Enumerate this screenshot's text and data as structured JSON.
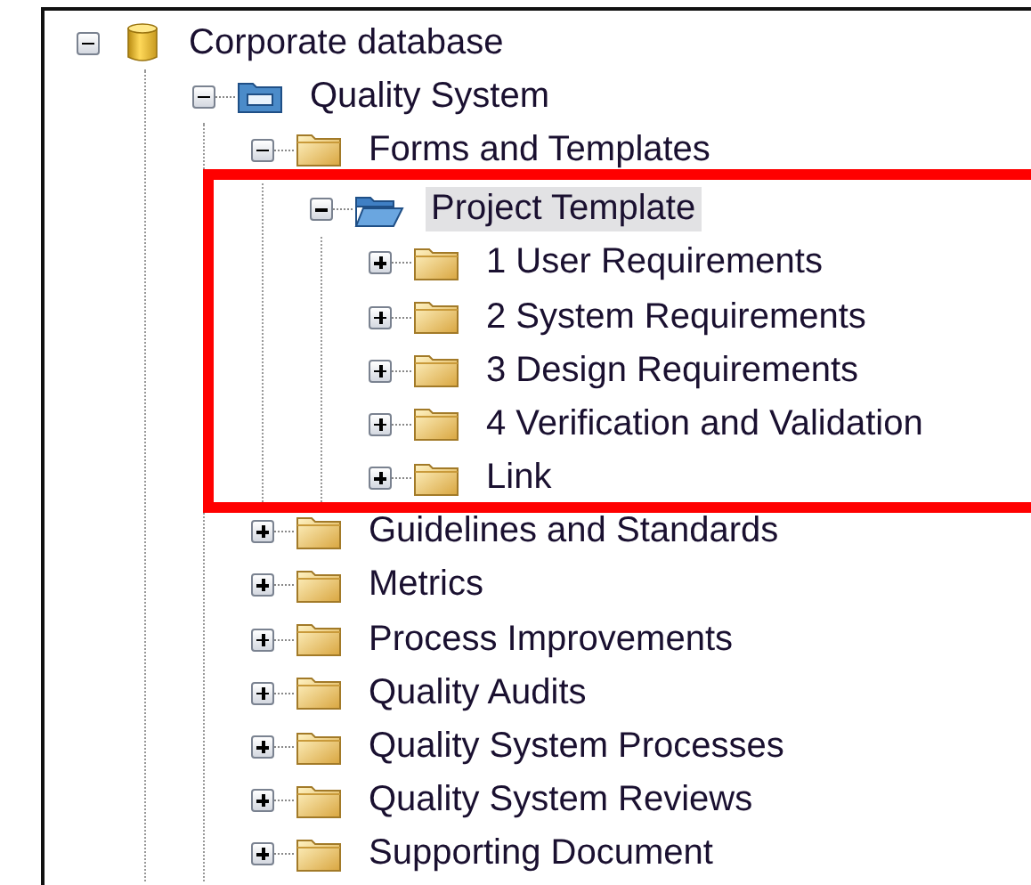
{
  "tree": [
    {
      "label": "Corporate database",
      "kind": "database",
      "expanded": true,
      "selected": false,
      "children": [
        {
          "label": "Quality System",
          "kind": "module",
          "expanded": true,
          "selected": false,
          "children": [
            {
              "label": "Forms and Templates",
              "kind": "folder",
              "expanded": true,
              "selected": false,
              "children": [
                {
                  "label": "Project Template",
                  "kind": "open-folder",
                  "expanded": true,
                  "selected": true,
                  "highlighted": true,
                  "children": [
                    {
                      "label": "1 User Requirements",
                      "kind": "folder",
                      "expanded": false,
                      "selected": false
                    },
                    {
                      "label": "2  System Requirements",
                      "kind": "folder",
                      "expanded": false,
                      "selected": false
                    },
                    {
                      "label": "3 Design Requirements",
                      "kind": "folder",
                      "expanded": false,
                      "selected": false
                    },
                    {
                      "label": "4 Verification and Validation",
                      "kind": "folder",
                      "expanded": false,
                      "selected": false
                    },
                    {
                      "label": "Link",
                      "kind": "folder",
                      "expanded": false,
                      "selected": false
                    }
                  ]
                }
              ]
            },
            {
              "label": "Guidelines and Standards",
              "kind": "folder",
              "expanded": false,
              "selected": false
            },
            {
              "label": "Metrics",
              "kind": "folder",
              "expanded": false,
              "selected": false
            },
            {
              "label": "Process Improvements",
              "kind": "folder",
              "expanded": false,
              "selected": false
            },
            {
              "label": "Quality Audits",
              "kind": "folder",
              "expanded": false,
              "selected": false
            },
            {
              "label": "Quality System Processes",
              "kind": "folder",
              "expanded": false,
              "selected": false
            },
            {
              "label": "Quality System Reviews",
              "kind": "folder",
              "expanded": false,
              "selected": false
            },
            {
              "label": "Supporting Document",
              "kind": "folder",
              "expanded": false,
              "selected": false
            }
          ]
        }
      ]
    }
  ]
}
